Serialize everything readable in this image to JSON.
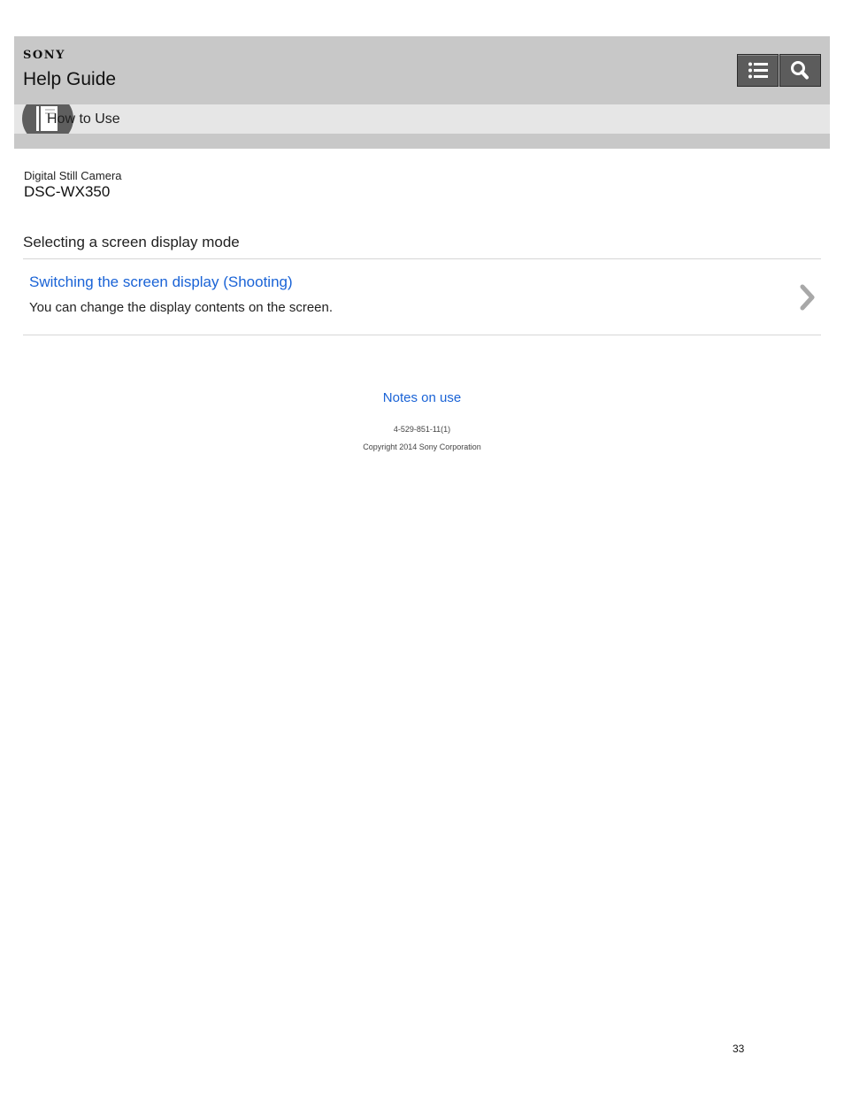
{
  "header": {
    "brand": "SONY",
    "title": "Help Guide",
    "toc_icon": "list-icon",
    "search_icon": "search-icon"
  },
  "category": {
    "label": "How to Use",
    "icon": "book-icon"
  },
  "product": {
    "type": "Digital Still Camera",
    "model": "DSC-WX350"
  },
  "section": {
    "title": "Selecting a screen display mode",
    "topics": [
      {
        "title": "Switching the screen display (Shooting)",
        "description": "You can change the display contents on the screen.",
        "icon": "chevron-right-icon"
      }
    ]
  },
  "footer": {
    "notes_link": "Notes on use",
    "doc_code": "4-529-851-11(1)",
    "copyright": "Copyright 2014 Sony Corporation"
  },
  "page_number": "33",
  "colors": {
    "header_bg": "#c8c8c8",
    "subbar_bg": "#e6e6e6",
    "button_bg": "#5c5c5c",
    "link": "#1a63d6"
  }
}
